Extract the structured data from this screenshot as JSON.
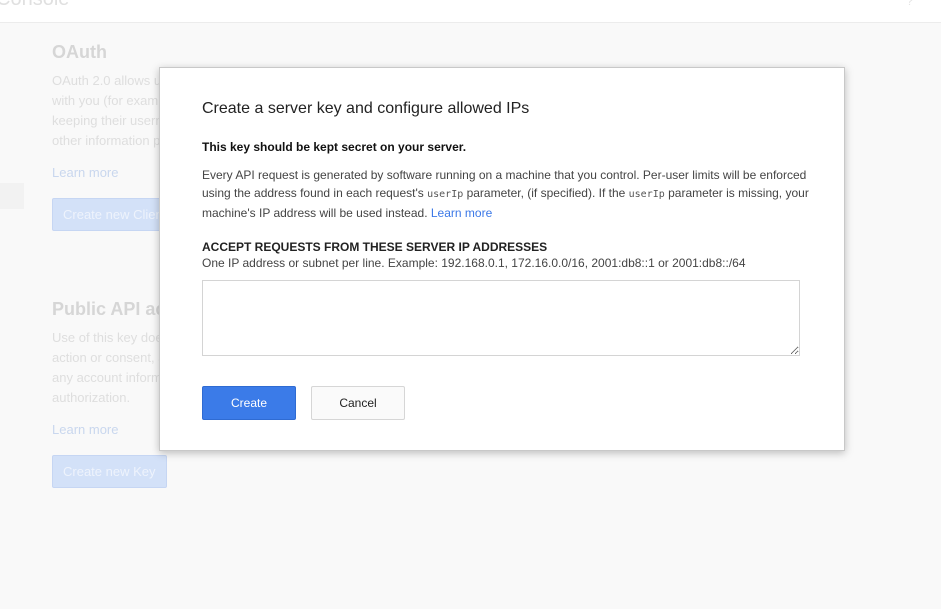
{
  "background": {
    "brand_text": "Console",
    "corner_glyph": "?",
    "oauth": {
      "title": "OAuth",
      "description_lines": [
        "OAuth 2.0 allows u",
        "with you (for exam",
        "keeping their usern",
        "other information p"
      ],
      "learn_more": "Learn more",
      "button_label": "Create new Clien"
    },
    "public_api": {
      "title": "Public API acc",
      "description_lines": [
        "Use of this key doe",
        "action or consent, a",
        "any account inform",
        "authorization."
      ],
      "learn_more": "Learn more",
      "button_label": "Create new Key"
    }
  },
  "dialog": {
    "title": "Create a server key and configure allowed IPs",
    "warning": "This key should be kept secret on your server.",
    "description": {
      "part1": "Every API request is generated by software running on a machine that you control. Per-user limits will be enforced using the address found in each request's ",
      "code1": "userIp",
      "part2": " parameter, (if specified). If the ",
      "code2": "userIp",
      "part3": " parameter is missing, your machine's IP address will be used instead. ",
      "learn_more": "Learn more"
    },
    "field_label": "ACCEPT REQUESTS FROM THESE SERVER IP ADDRESSES",
    "field_hint": "One IP address or subnet per line. Example: 192.168.0.1, 172.16.0.0/16, 2001:db8::1 or 2001:db8::/64",
    "textarea_value": "",
    "create_label": "Create",
    "cancel_label": "Cancel"
  },
  "colors": {
    "primary_button": "#3b7be8",
    "link": "#3b78e7"
  }
}
